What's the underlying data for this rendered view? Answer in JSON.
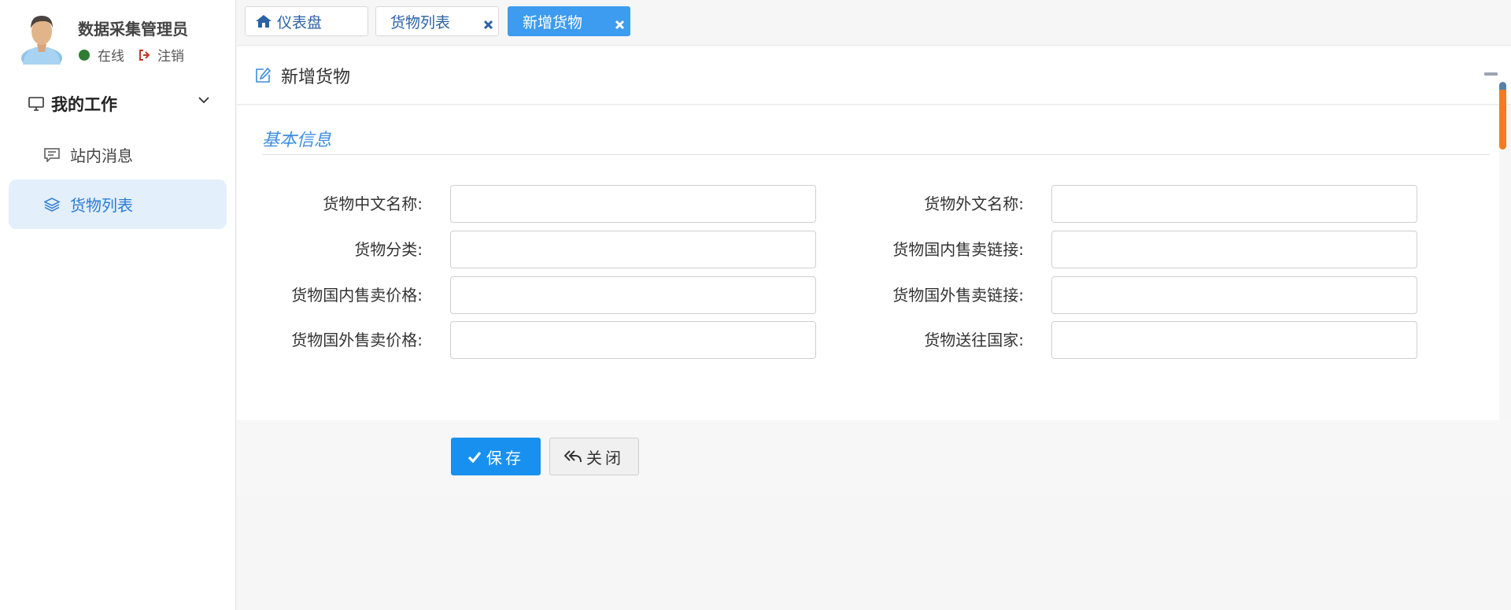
{
  "user": {
    "name": "数据采集管理员",
    "status": "在线",
    "logout": "注销"
  },
  "menu": {
    "group_title": "我的工作",
    "items": [
      {
        "label": "站内消息",
        "icon": "message-icon",
        "active": false
      },
      {
        "label": "货物列表",
        "icon": "layers-icon",
        "active": true
      }
    ]
  },
  "tabs": [
    {
      "label": "仪表盘",
      "icon": "home-icon",
      "closable": false,
      "active": false
    },
    {
      "label": "货物列表",
      "closable": true,
      "active": false
    },
    {
      "label": "新增货物",
      "closable": true,
      "active": true
    }
  ],
  "panel": {
    "title": "新增货物",
    "section_title": "基本信息"
  },
  "form": {
    "left": [
      {
        "label": "货物中文名称:",
        "value": ""
      },
      {
        "label": "货物分类:",
        "value": ""
      },
      {
        "label": "货物国内售卖价格:",
        "value": ""
      },
      {
        "label": "货物国外售卖价格:",
        "value": ""
      }
    ],
    "right": [
      {
        "label": "货物外文名称:",
        "value": ""
      },
      {
        "label": "货物国内售卖链接:",
        "value": ""
      },
      {
        "label": "货物国外售卖链接:",
        "value": ""
      },
      {
        "label": "货物送往国家:",
        "value": ""
      }
    ]
  },
  "buttons": {
    "save": "保存",
    "close": "关闭"
  },
  "colors": {
    "accent": "#1890f0",
    "active_tab": "#3d9bf0",
    "active_menu_bg": "#e3effb",
    "online": "#2e7d32"
  }
}
